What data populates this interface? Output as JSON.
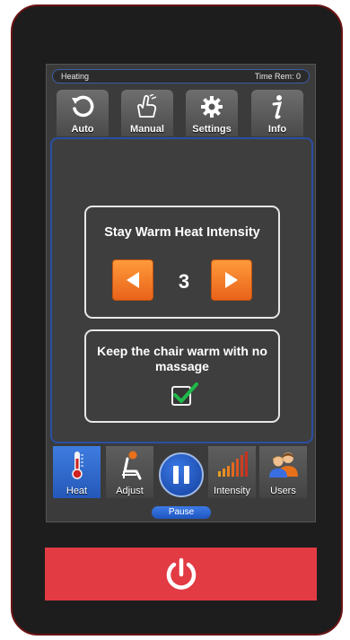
{
  "status": {
    "mode": "Heating",
    "time_remaining": "Time Rem: 0"
  },
  "top_tabs": [
    {
      "label": "Auto",
      "icon": "refresh-icon"
    },
    {
      "label": "Manual",
      "icon": "hand-pointer-icon"
    },
    {
      "label": "Settings",
      "icon": "gear-icon"
    },
    {
      "label": "Info",
      "icon": "info-icon"
    }
  ],
  "heat_intensity": {
    "title": "Stay Warm Heat Intensity",
    "value": "3"
  },
  "stay_warm": {
    "label": "Keep the chair warm with no massage",
    "checked": true
  },
  "bottom_tabs": [
    {
      "label": "Heat",
      "icon": "thermometer-icon",
      "active": true
    },
    {
      "label": "Adjust",
      "icon": "chair-adjust-icon",
      "active": false
    },
    {
      "label": "Intensity",
      "icon": "intensity-bars-icon",
      "active": false
    },
    {
      "label": "Users",
      "icon": "users-icon",
      "active": false
    }
  ],
  "pause": {
    "label": "Pause"
  },
  "colors": {
    "accent_orange": "#f07a25",
    "active_blue": "#2f6bd6",
    "power_red": "#e23b44",
    "check_green": "#1fb84a"
  }
}
